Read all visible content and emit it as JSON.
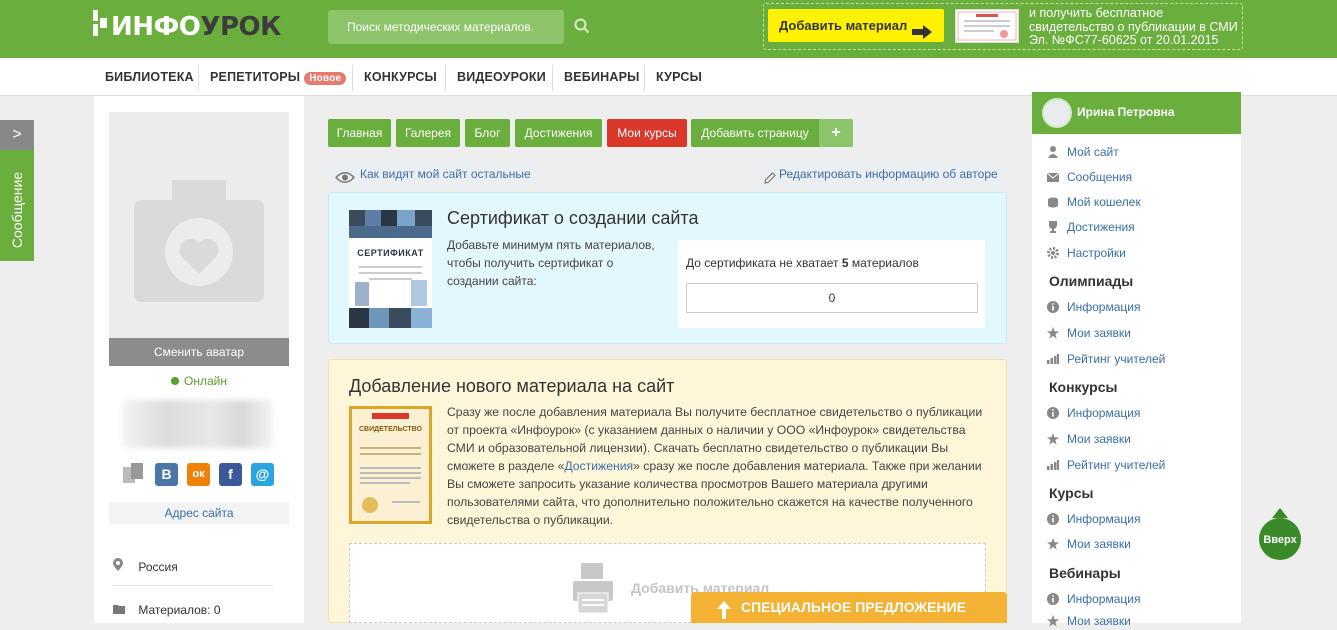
{
  "header": {
    "logo_prefix": "ИНФО",
    "logo_suffix": "УРОК",
    "search_placeholder": "Поиск методических материалов.",
    "add_material": "Добавить материал",
    "promo_text": "и получить бесплатное свидетельство о публикации в СМИ Эл. №ФС77-60625 от 20.01.2015"
  },
  "nav": {
    "items": [
      "БИБЛИОТЕКА",
      "РЕПЕТИТОРЫ",
      "КОНКУРСЫ",
      "ВИДЕОУРОКИ",
      "ВЕБИНАРЫ",
      "КУРСЫ"
    ],
    "badge": "Новое"
  },
  "sidetab": {
    "label": "Сообщение",
    "arrow": ">"
  },
  "left": {
    "change_avatar": "Сменить аватар",
    "status": "Онлайн",
    "social": [
      "B",
      "ок",
      "f",
      "@"
    ],
    "site_address": "Адрес сайта",
    "country": "Россия",
    "materials": "Материалов: 0"
  },
  "tabs": [
    "Главная",
    "Галерея",
    "Блог",
    "Достижения",
    "Мои курсы",
    "Добавить страницу",
    "+"
  ],
  "view_as_others": "Как видят мой сайт остальные",
  "edit_author": "Редактировать информацию об авторе",
  "certificate": {
    "title": "Сертификат о создании сайта",
    "text": "Добавьте минимум пять материалов, чтобы получить сертификат о создании сайта:",
    "remaining_prefix": "До сертификата не хватает",
    "remaining_count": "5",
    "remaining_suffix": "материалов",
    "value": "0",
    "image_caption": "СЕРТИФИКАТ"
  },
  "add_material": {
    "title": "Добавление нового материала на сайт",
    "text_before": "Сразу же после добавления материала Вы получите бесплатное свидетельство о публикации от проекта «Инфоурок» (с указанием данных о наличии у ООО «Инфоурок» свидетельства СМИ и образовательной лицензии). Скачать бесплатно свидетельство о публикации Вы сможете в разделе «",
    "link": "Достижения",
    "text_after": "» сразу же после добавления материала. Также при желании Вы сможете запросить указание количества просмотров Вашего материала другими пользователями сайта, что дополнительно положительно скажется на качестве полученного свидетельства о публикации.",
    "image_caption": "СВИДЕТЕЛЬСТВО",
    "dropzone_label": "Добавить материал",
    "special_offer": "СПЕЦИАЛЬНОЕ ПРЕДЛОЖЕНИЕ"
  },
  "right": {
    "user_name": "Ирина Петровна",
    "menu": [
      "Мой сайт",
      "Сообщения",
      "Мой кошелек",
      "Достижения",
      "Настройки"
    ],
    "olympiads": {
      "title": "Олимпиады",
      "items": [
        "Информация",
        "Мои заявки",
        "Рейтинг учителей"
      ]
    },
    "contests": {
      "title": "Конкурсы",
      "items": [
        "Информация",
        "Мои заявки",
        "Рейтинг учителей"
      ]
    },
    "courses": {
      "title": "Курсы",
      "items": [
        "Информация",
        "Мои заявки"
      ]
    },
    "webinars": {
      "title": "Вебинары",
      "items": [
        "Информация",
        "Мои заявки"
      ]
    }
  },
  "up_button": "Вверх",
  "colors": {
    "brand_green": "#6aaf3d",
    "yellow": "#fff200",
    "red": "#d9382b",
    "orange": "#f3b234"
  }
}
